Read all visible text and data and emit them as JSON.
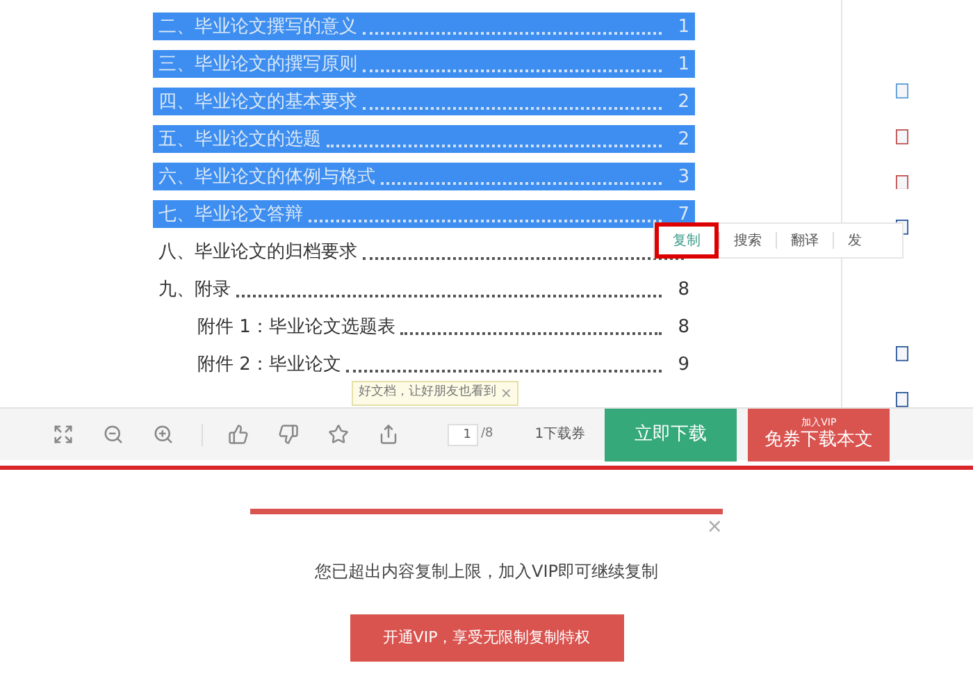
{
  "toc": [
    {
      "title": "二、毕业论文撰写的意义",
      "page": "1",
      "selected": true
    },
    {
      "title": "三、毕业论文的撰写原则",
      "page": "1",
      "selected": true
    },
    {
      "title": "四、毕业论文的基本要求",
      "page": "2",
      "selected": true
    },
    {
      "title": "五、毕业论文的选题",
      "page": "2",
      "selected": true
    },
    {
      "title": "六、毕业论文的体例与格式",
      "page": "3",
      "selected": true
    },
    {
      "title": "七、毕业论文答辩",
      "page": "7",
      "selected": true
    },
    {
      "title": "八、毕业论文的归档要求",
      "selected": false
    },
    {
      "title": "九、附录",
      "page": "8",
      "selected": false,
      "children": [
        {
          "title": "附件 1：毕业论文选题表",
          "page": "8",
          "selected": false
        },
        {
          "title": "附件 2：毕业论文",
          "page": "9",
          "selected": false
        }
      ]
    }
  ],
  "context_menu": [
    {
      "label": "复制",
      "selected": true
    },
    {
      "label": "搜索",
      "selected": false
    },
    {
      "label": "翻译",
      "selected": false
    },
    {
      "label": "发",
      "selected": false
    }
  ],
  "tooltip": {
    "text": "好文档，让好朋友也看到",
    "close": "×"
  },
  "toolbar": {
    "page": "1",
    "total": "/8",
    "coupon": "1下载券",
    "download": "立即下载",
    "vip_badge": "加入VIP",
    "vip_download": "免券下载本文"
  },
  "dialog": {
    "close": "×",
    "message": "您已超出内容复制上限，加入VIP即可继续复制",
    "button": "开通VIP，享受无限制复制特权"
  }
}
